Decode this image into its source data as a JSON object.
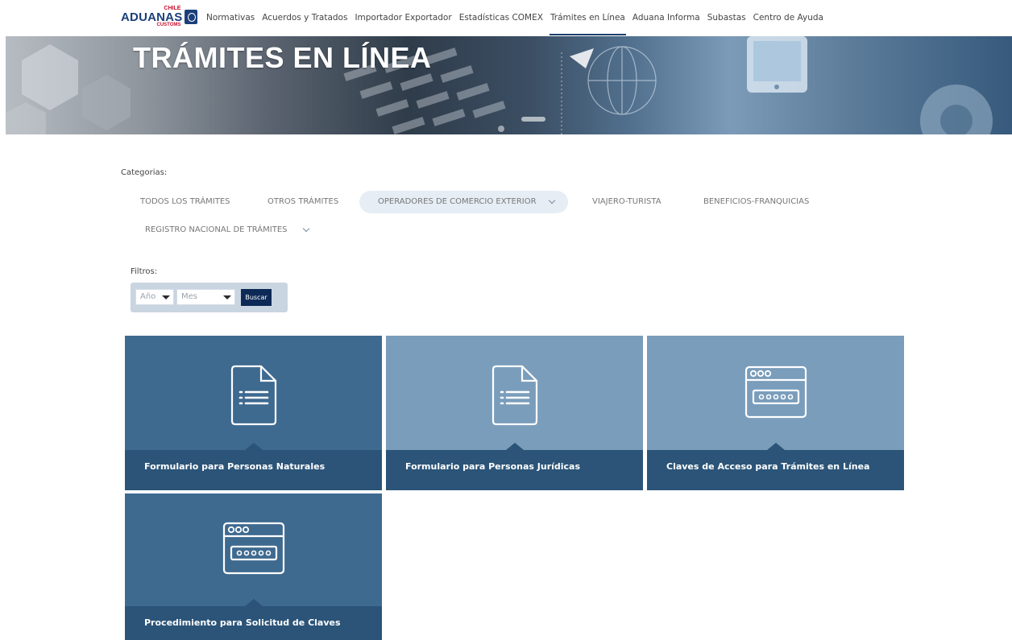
{
  "brand": {
    "logo_small": "CHILE",
    "logo_main": "ADUANAS",
    "logo_sub": "CUSTOMS"
  },
  "nav": {
    "items": [
      {
        "label": "Normativas"
      },
      {
        "label": "Acuerdos y Tratados"
      },
      {
        "label": "Importador Exportador"
      },
      {
        "label": "Estadísticas COMEX"
      },
      {
        "label": "Trámites en Línea",
        "active": true
      },
      {
        "label": "Aduana Informa"
      },
      {
        "label": "Subastas"
      },
      {
        "label": "Centro de Ayuda"
      }
    ]
  },
  "banner": {
    "title": "TRÁMITES EN LÍNEA"
  },
  "categories": {
    "label": "Categorias:",
    "items": [
      {
        "label": "TODOS LOS TRÁMITES"
      },
      {
        "label": "OTROS TRÁMITES"
      },
      {
        "label": "OPERADORES DE COMERCIO EXTERIOR",
        "active": true,
        "has_dropdown": true
      },
      {
        "label": "VIAJERO-TURISTA"
      },
      {
        "label": "BENEFICIOS-FRANQUICIAS"
      },
      {
        "label": "REGISTRO NACIONAL DE TRÁMITES",
        "has_dropdown": true
      }
    ]
  },
  "filters": {
    "label": "Filtros:",
    "year_placeholder": "Año",
    "month_placeholder": "Mes",
    "search_label": "Buscar"
  },
  "cards": [
    {
      "title": "Formulario para Personas Naturales",
      "icon": "document-icon"
    },
    {
      "title": "Formulario para Personas Jurídicas",
      "icon": "document-icon"
    },
    {
      "title": "Claves de Acceso para Trámites en Línea",
      "icon": "password-window-icon"
    },
    {
      "title": "Procedimiento para Solicitud de Claves",
      "icon": "password-window-icon"
    }
  ],
  "colors": {
    "nav_active": "#1d3f6e",
    "card_dark": "#3f6a90",
    "card_light": "#7a9dbb",
    "card_footer": "#2b5478",
    "search_button": "#0d2a57",
    "filter_box": "#c9d5e1"
  }
}
